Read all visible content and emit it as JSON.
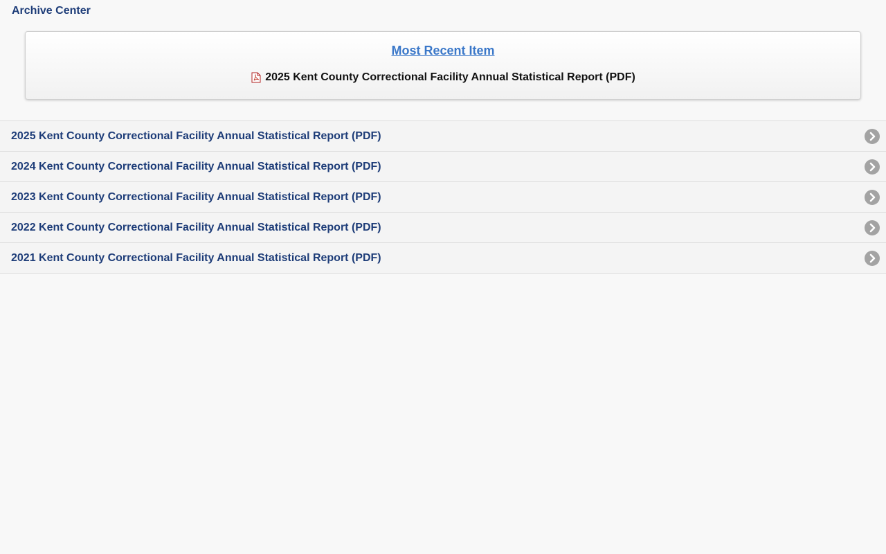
{
  "header": {
    "title": "Archive Center"
  },
  "recent": {
    "heading": "Most Recent Item",
    "item_label": "2025 Kent County Correctional Facility Annual Statistical Report (PDF)",
    "icon": "pdf-icon"
  },
  "archive": {
    "items": [
      {
        "label": "2025 Kent County Correctional Facility Annual Statistical Report (PDF)"
      },
      {
        "label": "2024 Kent County Correctional Facility Annual Statistical Report (PDF)"
      },
      {
        "label": "2023 Kent County Correctional Facility Annual Statistical Report (PDF)"
      },
      {
        "label": "2022 Kent County Correctional Facility Annual Statistical Report (PDF)"
      },
      {
        "label": "2021 Kent County Correctional Facility Annual Statistical Report (PDF)"
      }
    ],
    "item_icon": "chevron-right-icon"
  },
  "colors": {
    "link_blue": "#1d3c78",
    "heading_blue": "#3b78c9",
    "chevron_gray": "#a3a3a3",
    "background": "#f8f8f8"
  }
}
